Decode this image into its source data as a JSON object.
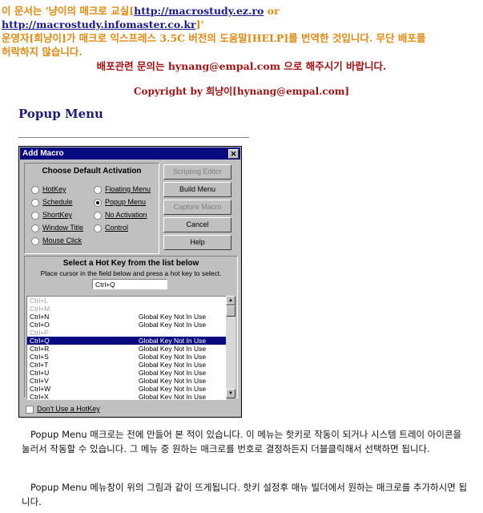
{
  "header": {
    "line1_prefix": "이 문서는 '냥이의 매크로 교실[",
    "link1": "http://macrostudy.ez.ro",
    "line1_or": " or ",
    "link2": "http://macrostudy.infomaster.co.kr",
    "line1_suffix": "]'",
    "line2": "운영자[희냥이]가 매크로 익스프레스 3.5C 버전의 도움말[HELP]를 번역한 것입니다. 무단 배포를",
    "line3": "허락하지 않습니다.",
    "color": "#e08a12"
  },
  "contact": {
    "prefix": "배포관련 문의는 ",
    "email": "hynang@empal.com",
    "suffix": " 으로 해주시기 바랍니다."
  },
  "copyright": "Copyright by 희냥이[hynang@empal.com]",
  "page_title": "Popup Menu",
  "dialog": {
    "title": "Add Macro",
    "close_glyph": "✕",
    "activation_title": "Choose Default Activation",
    "options_left": [
      {
        "label": "HotKey",
        "selected": false
      },
      {
        "label": "Schedule",
        "selected": false
      },
      {
        "label": "ShortKey",
        "selected": false
      },
      {
        "label": "Window Title",
        "selected": false
      },
      {
        "label": "Mouse Click",
        "selected": false
      }
    ],
    "options_right": [
      {
        "label": "Floating Menu",
        "selected": false
      },
      {
        "label": "Popup Menu",
        "selected": true
      },
      {
        "label": "No Activation",
        "selected": false
      },
      {
        "label": "Control",
        "selected": false
      }
    ],
    "buttons": [
      {
        "label": "Scripting Editor",
        "enabled": false
      },
      {
        "label": "Build Menu",
        "enabled": true
      },
      {
        "label": "Capture Macro",
        "enabled": false
      },
      {
        "label": "Cancel",
        "enabled": true
      },
      {
        "label": "Help",
        "enabled": true
      }
    ],
    "hotkey_title": "Select a Hot Key from the list below",
    "hotkey_hint": "Place cursor in the field below and press a hot key to select.",
    "hotkey_value": "Ctrl+Q",
    "hotkey_rows": [
      {
        "key": "Ctrl+L",
        "status": "",
        "dim": true
      },
      {
        "key": "Ctrl+M",
        "status": "",
        "dim": true
      },
      {
        "key": "Ctrl+N",
        "status": "Global Key Not In Use",
        "dim": false
      },
      {
        "key": "Ctrl+O",
        "status": "Global Key Not In Use",
        "dim": false
      },
      {
        "key": "Ctrl+P",
        "status": "",
        "dim": true
      },
      {
        "key": "Ctrl+Q",
        "status": "Global Key Not In Use",
        "dim": false,
        "selected": true
      },
      {
        "key": "Ctrl+R",
        "status": "Global Key Not In Use",
        "dim": false
      },
      {
        "key": "Ctrl+S",
        "status": "Global Key Not In Use",
        "dim": false
      },
      {
        "key": "Ctrl+T",
        "status": "Global Key Not In Use",
        "dim": false
      },
      {
        "key": "Ctrl+U",
        "status": "Global Key Not In Use",
        "dim": false
      },
      {
        "key": "Ctrl+V",
        "status": "Global Key Not In Use",
        "dim": false
      },
      {
        "key": "Ctrl+W",
        "status": "Global Key Not In Use",
        "dim": false
      },
      {
        "key": "Ctrl+X",
        "status": "Global Key Not In Use",
        "dim": false
      }
    ],
    "checkbox_label": "Don't Use a HotKey",
    "checkbox_checked": false,
    "scroll_up": "▲",
    "scroll_down": "▼"
  },
  "paragraphs": [
    "Popup Menu 매크로는 전에 만들어 본 적이 있습니다. 이 메뉴는 핫키로 작동이 되거나 시스템 트레이 아이콘을 눌러서 작동할 수 있습니다. 그 메뉴 중 원하는 매크로를 번호로 결정하든지 더블클릭해서 선택하면 됩니다.",
    "Popup Menu 메뉴창이 위의 그림과 같이 뜨게됩니다. 핫키 설정후 매뉴 빌더에서 원하는 매크로를 추가하시면 됩니다."
  ]
}
